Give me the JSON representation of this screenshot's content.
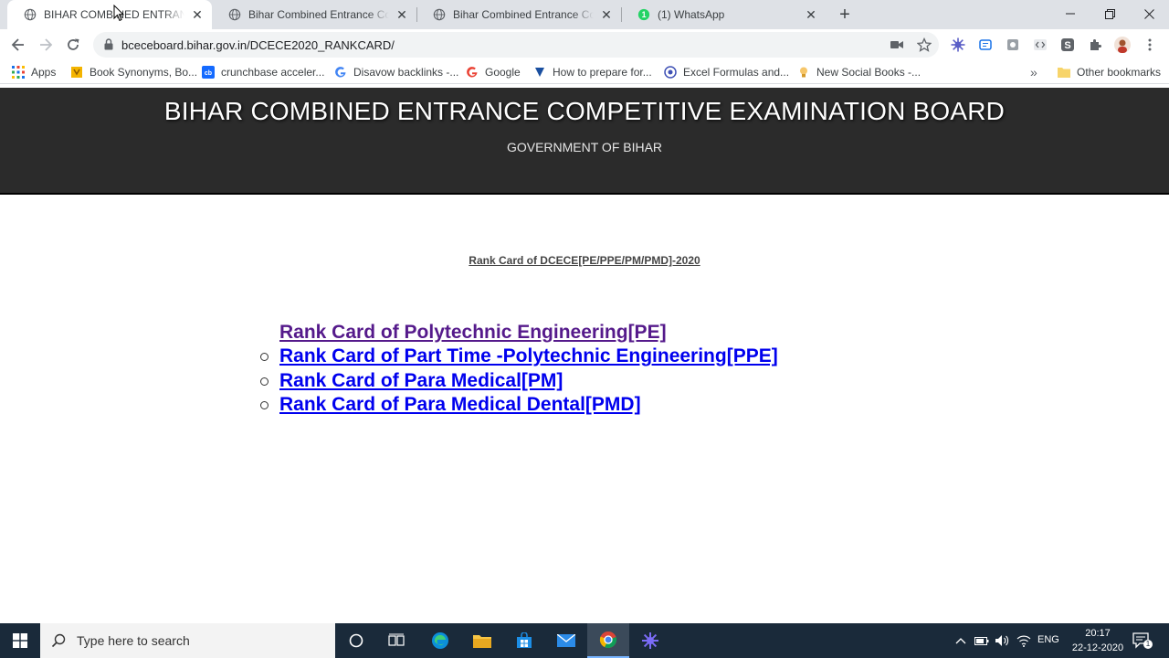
{
  "browser": {
    "tabs": [
      {
        "title": "BIHAR COMBINED ENTRANCE COMPETITIVE EXAMINATION BOARD",
        "active": true
      },
      {
        "title": "Bihar Combined Entrance Competitive Examination Board",
        "active": false
      },
      {
        "title": "Bihar Combined Entrance Competitive Examination Board",
        "active": false
      },
      {
        "title": "(1) WhatsApp",
        "active": false
      }
    ],
    "url": "bceceboard.bihar.gov.in/DCECE2020_RANKCARD/",
    "bookmarks": [
      {
        "label": "Apps",
        "icon": "apps-grid-icon"
      },
      {
        "label": "Book Synonyms, Bo...",
        "icon": "book-icon"
      },
      {
        "label": "crunchbase acceler...",
        "icon": "crunchbase-icon"
      },
      {
        "label": "Disavow backlinks -...",
        "icon": "google-icon"
      },
      {
        "label": "Google",
        "icon": "google-icon"
      },
      {
        "label": "How to prepare for...",
        "icon": "bookmark-icon"
      },
      {
        "label": "Excel Formulas and...",
        "icon": "site-icon"
      },
      {
        "label": "New Social Books -...",
        "icon": "lightbulb-icon"
      }
    ],
    "other_bookmarks": "Other bookmarks"
  },
  "page": {
    "header_title": "BIHAR COMBINED ENTRANCE COMPETITIVE EXAMINATION BOARD",
    "header_subtitle": "GOVERNMENT OF BIHAR",
    "rank_title": "Rank Card of DCECE[PE/PPE/PM/PMD]-2020",
    "links": [
      {
        "label": "Rank Card of Polytechnic Engineering[PE]",
        "visited": true,
        "bullet": false
      },
      {
        "label": "Rank Card of Part Time -Polytechnic Engineering[PPE]",
        "visited": false,
        "bullet": true
      },
      {
        "label": "Rank Card of Para Medical[PM]",
        "visited": false,
        "bullet": true
      },
      {
        "label": "Rank Card of Para Medical Dental[PMD]",
        "visited": false,
        "bullet": true
      }
    ]
  },
  "taskbar": {
    "search_placeholder": "Type here to search",
    "language": "ENG",
    "time": "20:17",
    "date": "22-12-2020",
    "notification_count": "1"
  },
  "colors": {
    "link": "#0000ee",
    "link_visited": "#551a8b",
    "banner_bg": "#2b2b2b",
    "taskbar_bg": "#1a2a3a"
  }
}
